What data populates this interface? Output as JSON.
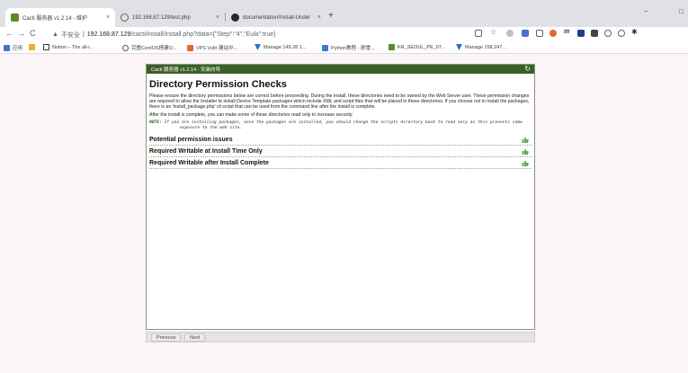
{
  "browser": {
    "tabs": [
      {
        "title": "Cacti 服务器 v1.2.14 - 维护",
        "close": "×"
      },
      {
        "title": "192.168.87.129/test.php",
        "close": "×"
      },
      {
        "title": "documentation/Install-Under",
        "close": "×"
      }
    ],
    "new_tab": "+",
    "window_controls": {
      "minimize": "−",
      "maximize": "□"
    },
    "nav": {
      "back": "←",
      "forward": "→",
      "reload": "C"
    },
    "address": {
      "security_label": "不安全",
      "host": "192.168.87.129",
      "path": "/cacti/install/install.php?data={\"Step\":\"4\",\"Eula\":true}"
    },
    "bookmarks": [
      {
        "label": "应用"
      },
      {
        "label": "Notion – The all-i..."
      },
      {
        "label": "完整CentOS搭建O..."
      },
      {
        "label": "VPS Vultr 建站中..."
      },
      {
        "label": "Manage 149.28.1..."
      },
      {
        "label": "Python教程 - 廖雪..."
      },
      {
        "label": "KR_SEOUL_PE_67..."
      },
      {
        "label": "Manage 158.247..."
      }
    ]
  },
  "dialog": {
    "header_title": "Cacti 服务器 v1.2.14 - 安装向导",
    "page_title": "Directory Permission Checks",
    "paragraph1": "Please ensure the directory permissions below are correct before proceeding. During the install, these directories need to be owned by the Web Server user. These permission changes are required to allow the Installer to install Device Template packages which include XML and script files that will be placed in these directories. If you choose not to install the packages, there is an 'install_package.php' cli script that can be used from the command line after the install is complete.",
    "paragraph2": "After the install is complete, you can make some of these directories read only to increase security.",
    "note_label": "NOTE:",
    "note_text": " If you are installing packages, once the packages are installed, you should change the scripts directory back to read only as this presents some exposure to the web site.",
    "sections": [
      {
        "title": "Potential permission issues",
        "status_icon": "thumbs-up-icon"
      },
      {
        "title": "Required Writable at Install Time Only",
        "status_icon": "thumbs-up-icon"
      },
      {
        "title": "Required Writable after Install Complete",
        "status_icon": "thumbs-up-icon"
      }
    ],
    "buttons": {
      "previous": "Previous",
      "next": "Next"
    }
  },
  "colors": {
    "header_green": "#3c5f2a",
    "thumb_green": "#6aa84f",
    "page_bg": "#fbf5f7"
  }
}
